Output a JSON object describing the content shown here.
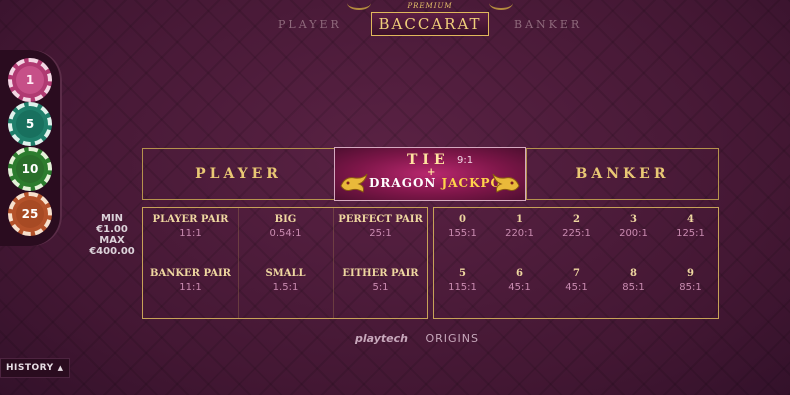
{
  "header": {
    "left_label": "PLAYER",
    "right_label": "BANKER",
    "logo_top": "PREMIUM",
    "logo_main": "BACCARAT"
  },
  "chips": [
    {
      "value": "1",
      "color": "#b03a72"
    },
    {
      "value": "5",
      "color": "#1f7f6b"
    },
    {
      "value": "10",
      "color": "#2c7c2e"
    },
    {
      "value": "25",
      "color": "#b4522a"
    }
  ],
  "main_bets": {
    "player": "PLAYER",
    "banker": "BANKER",
    "tie": {
      "label": "TIE",
      "odds": "9:1",
      "plus": "+",
      "jackpot_left": "DRAGON",
      "jackpot_right": "JACKPOT"
    }
  },
  "limits": {
    "min_label": "MIN",
    "min_value": "€1.00",
    "max_label": "MAX",
    "max_value": "€400.00"
  },
  "side_bets": [
    {
      "name": "PLAYER PAIR",
      "odds": "11:1"
    },
    {
      "name": "BIG",
      "odds": "0.54:1"
    },
    {
      "name": "PERFECT PAIR",
      "odds": "25:1"
    },
    {
      "name": "BANKER PAIR",
      "odds": "11:1"
    },
    {
      "name": "SMALL",
      "odds": "1.5:1"
    },
    {
      "name": "EITHER PAIR",
      "odds": "5:1"
    }
  ],
  "number_bets": [
    {
      "name": "0",
      "odds": "155:1"
    },
    {
      "name": "1",
      "odds": "220:1"
    },
    {
      "name": "2",
      "odds": "225:1"
    },
    {
      "name": "3",
      "odds": "200:1"
    },
    {
      "name": "4",
      "odds": "125:1"
    },
    {
      "name": "5",
      "odds": "115:1"
    },
    {
      "name": "6",
      "odds": "45:1"
    },
    {
      "name": "7",
      "odds": "45:1"
    },
    {
      "name": "8",
      "odds": "85:1"
    },
    {
      "name": "9",
      "odds": "85:1"
    }
  ],
  "footer": {
    "brand1": "playtech",
    "brand2": "ORIGINS",
    "history": "HISTORY"
  },
  "colors": {
    "gold": "#e8c36a",
    "background": "#4a1a38",
    "tie_magenta": "#b8286e"
  }
}
